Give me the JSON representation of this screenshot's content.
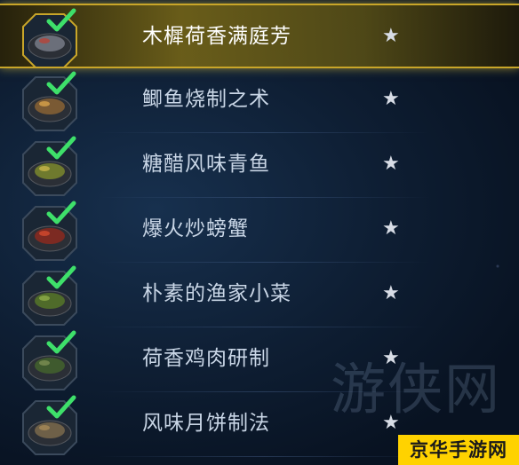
{
  "recipes": [
    {
      "name": "木樨荷香满庭芳",
      "rating": "★",
      "checked": true,
      "selected": true,
      "dish": "dark-round-cakes",
      "dish_color": "#6b6f7a",
      "accent": "#b8433a"
    },
    {
      "name": "鲫鱼烧制之术",
      "rating": "★",
      "checked": true,
      "selected": false,
      "dish": "braised-fish",
      "dish_color": "#7a5a34",
      "accent": "#d9a24a"
    },
    {
      "name": "糖醋风味青鱼",
      "rating": "★",
      "checked": true,
      "selected": false,
      "dish": "sweet-sour-fish",
      "dish_color": "#6f7a2e",
      "accent": "#c9b74a"
    },
    {
      "name": "爆火炒螃蟹",
      "rating": "★",
      "checked": true,
      "selected": false,
      "dish": "fried-crab",
      "dish_color": "#7c2a22",
      "accent": "#d44a2e"
    },
    {
      "name": "朴素的渔家小菜",
      "rating": "★",
      "checked": true,
      "selected": false,
      "dish": "green-tofu-blocks",
      "dish_color": "#4f6b2a",
      "accent": "#8fae48"
    },
    {
      "name": "荷香鸡肉研制",
      "rating": "★",
      "checked": true,
      "selected": false,
      "dish": "lotus-leaf-chicken",
      "dish_color": "#3f5a2e",
      "accent": "#7d8f52"
    },
    {
      "name": "风味月饼制法",
      "rating": "★",
      "checked": true,
      "selected": false,
      "dish": "mooncakes",
      "dish_color": "#6e6048",
      "accent": "#a88a58"
    }
  ],
  "watermark": "游侠网",
  "site_logo": "京华手游网",
  "colors": {
    "selected_border": "#c9a629",
    "check_green": "#3ee06a",
    "frame": "#3b4a5c"
  }
}
